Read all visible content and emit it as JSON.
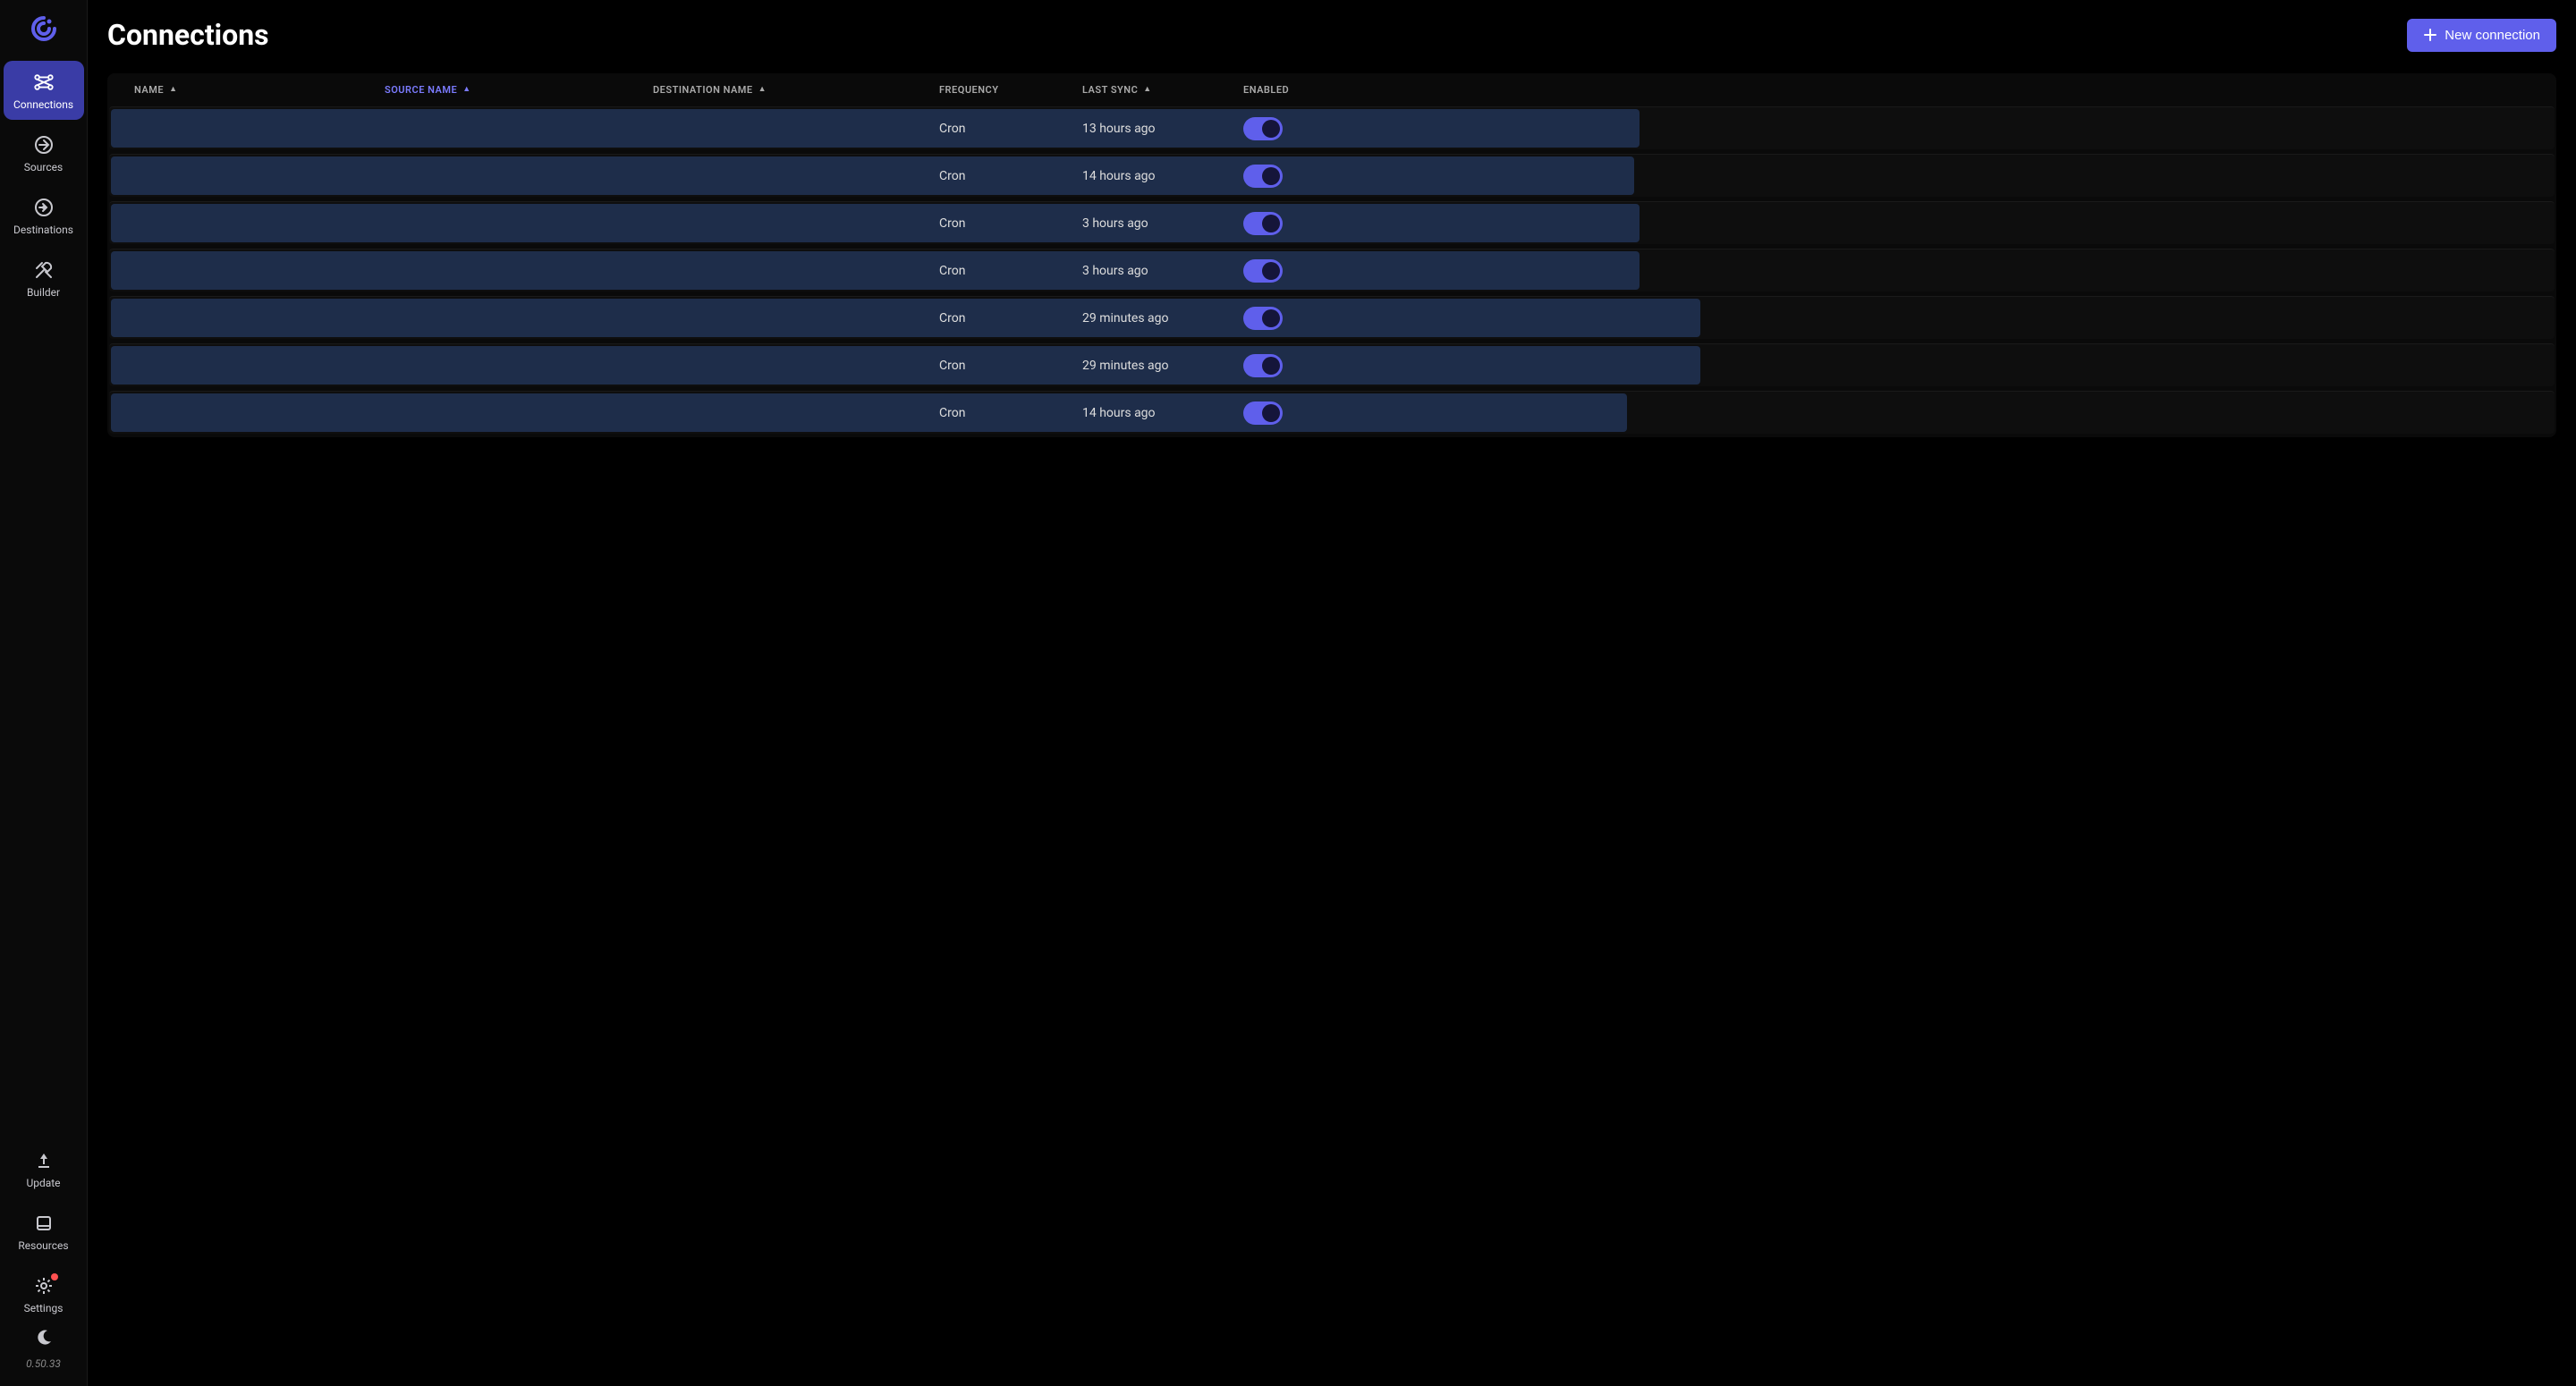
{
  "sidebar": {
    "items": [
      {
        "label": "Connections"
      },
      {
        "label": "Sources"
      },
      {
        "label": "Destinations"
      },
      {
        "label": "Builder"
      }
    ],
    "bottom": [
      {
        "label": "Update"
      },
      {
        "label": "Resources"
      },
      {
        "label": "Settings"
      }
    ],
    "version": "0.50.33"
  },
  "header": {
    "title": "Connections",
    "new_button": "New connection"
  },
  "table": {
    "columns": {
      "name": "Name",
      "source": "Source Name",
      "destination": "Destination Name",
      "frequency": "Frequency",
      "last_sync": "Last Sync",
      "enabled": "Enabled"
    },
    "rows": [
      {
        "frequency": "Cron",
        "last_sync": "13 hours ago",
        "enabled": true,
        "redact_pct": 62.5
      },
      {
        "frequency": "Cron",
        "last_sync": "14 hours ago",
        "enabled": true,
        "redact_pct": 62.3
      },
      {
        "frequency": "Cron",
        "last_sync": "3 hours ago",
        "enabled": true,
        "redact_pct": 62.5
      },
      {
        "frequency": "Cron",
        "last_sync": "3 hours ago",
        "enabled": true,
        "redact_pct": 62.5
      },
      {
        "frequency": "Cron",
        "last_sync": "29 minutes ago",
        "enabled": true,
        "redact_pct": 65
      },
      {
        "frequency": "Cron",
        "last_sync": "29 minutes ago",
        "enabled": true,
        "redact_pct": 65
      },
      {
        "frequency": "Cron",
        "last_sync": "14 hours ago",
        "enabled": true,
        "redact_pct": 62
      }
    ]
  }
}
